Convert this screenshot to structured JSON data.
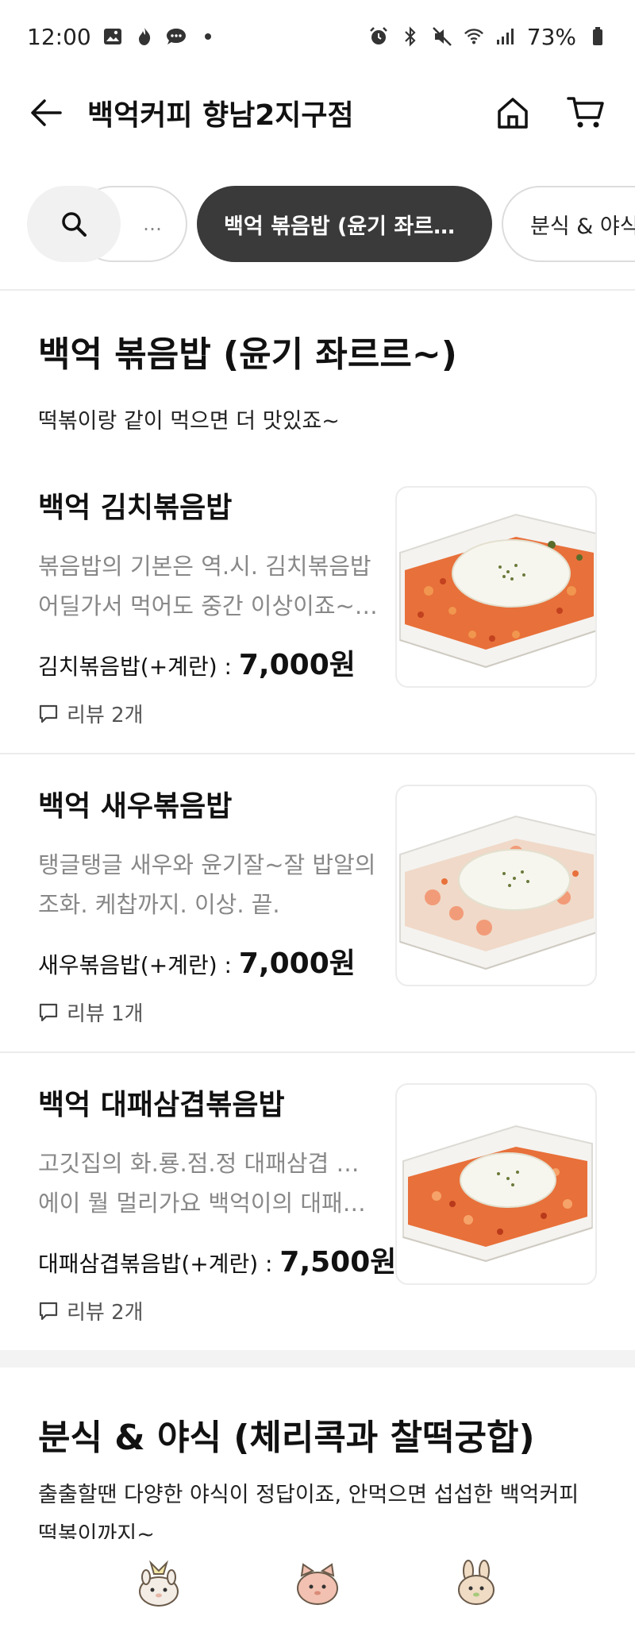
{
  "status_bar": {
    "time": "12:00",
    "battery": "73%"
  },
  "header": {
    "title": "백억커피 향남2지구점"
  },
  "chips": {
    "ghost_label": "…",
    "active_label": "백억 볶음밥 (윤기 좌르르…",
    "inactive_label": "분식 & 야식 (체"
  },
  "sections": [
    {
      "title": "백억 볶음밥 (윤기 좌르르~)",
      "description": "떡볶이랑 같이 먹으면 더 맛있죠~",
      "items": [
        {
          "name": "백억 김치볶음밥",
          "desc_line1": "볶음밥의 기본은 역.시. 김치볶음밥",
          "desc_line2": "어딜가서 먹어도 중간 이상이죠~ 백…",
          "price_label": "김치볶음밥(+계란) : ",
          "price": "7,000원",
          "review": "리뷰 2개",
          "topping": "kimchi"
        },
        {
          "name": "백억 새우볶음밥",
          "desc_line1": "탱글탱글 새우와 윤기잘~잘 밥알의",
          "desc_line2": "조화. 케찹까지. 이상. 끝.",
          "price_label": "새우볶음밥(+계란) : ",
          "price": "7,000원",
          "review": "리뷰 1개",
          "topping": "shrimp"
        },
        {
          "name": "백억 대패삼겹볶음밥",
          "desc_line1": "고깃집의 화.룡.점.정 대패삼겹 볶음밥",
          "desc_line2": "에이 뭘 멀리가요 백억이의 대패삼겹 …",
          "price_label": "대패삼겹볶음밥(+계란) : ",
          "price": "7,500원",
          "review": "리뷰 2개",
          "topping": "pork"
        }
      ]
    },
    {
      "title": "분식 & 야식 (체리콕과 찰떡궁합)",
      "description": "출출할땐 다양한 야식이 정답이죠, 안먹으면 섭섭한 백억커피 떡볶이까지~"
    }
  ],
  "bottom_nav": {
    "items": [
      "home-icon",
      "search-icon",
      "orders-icon"
    ]
  },
  "colors": {
    "active_chip": "#3a3a3a",
    "muted_text": "#888888",
    "divider": "#ececec",
    "rice": "#e8703a",
    "egg_white": "#f7f6ee"
  }
}
